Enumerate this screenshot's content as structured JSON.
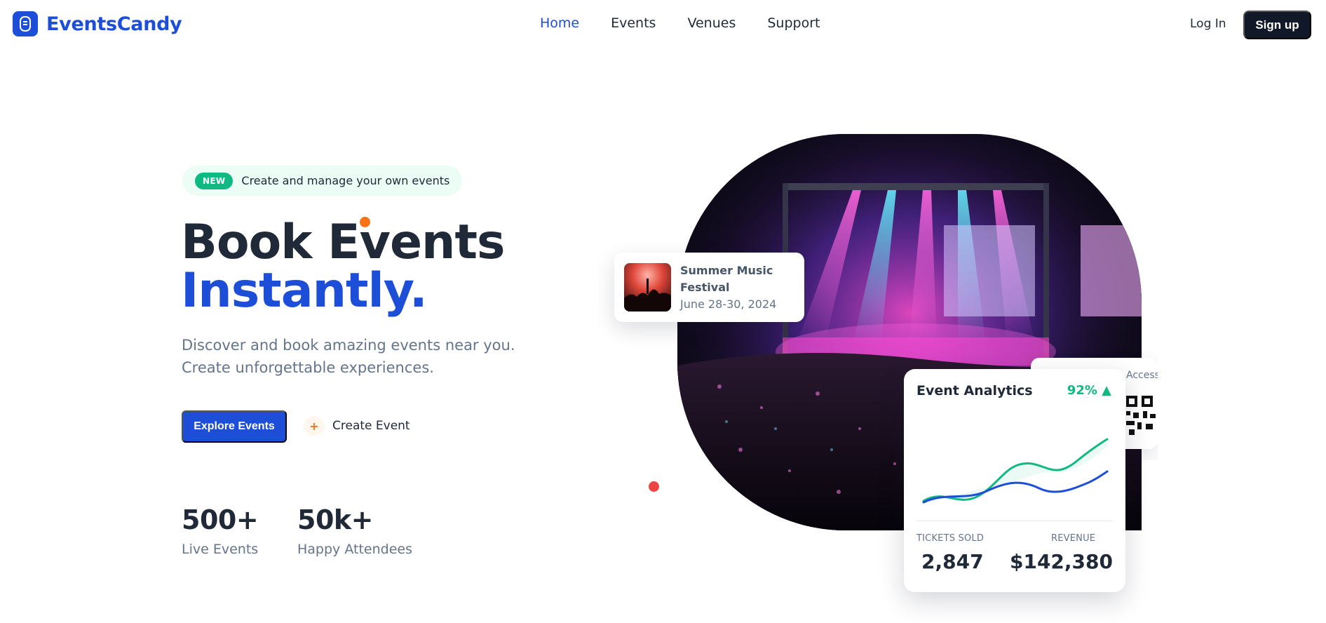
{
  "brand": {
    "name": "EventsCandy"
  },
  "nav": {
    "links": [
      {
        "label": "Home"
      },
      {
        "label": "Events"
      },
      {
        "label": "Venues"
      },
      {
        "label": "Support"
      }
    ],
    "login_label": "Log In",
    "signup_label": "Sign up"
  },
  "hero": {
    "badge": "NEW",
    "announcement": "Create and manage your own events",
    "title_line1": "Book Events",
    "title_line2": "Instantly.",
    "subtitle_line1": "Discover and book amazing events near you.",
    "subtitle_line2": "Create unforgettable experiences.",
    "primary_cta": "Explore Events",
    "secondary_cta": "Create Event",
    "stats": [
      {
        "value": "500+",
        "label": "Live Events"
      },
      {
        "value": "50k+",
        "label": "Happy Attendees"
      }
    ]
  },
  "event_card": {
    "name_line1": "Summer Music",
    "name_line2": "Festival",
    "date": "June 28-30, 2024"
  },
  "qr_card": {
    "label": "Access"
  },
  "analytics": {
    "title": "Event Analytics",
    "change": "92% ▲",
    "tickets_label": "TICKETS SOLD",
    "tickets_value": "2,847",
    "revenue_label": "REVENUE",
    "revenue_value": "$142,380"
  },
  "colors": {
    "brand_blue": "#1d4ed8",
    "dark": "#111827",
    "success": "#10b981",
    "accent_orange": "#f97316",
    "accent_red": "#ef4444"
  },
  "icons": {
    "logo": "ticket-icon",
    "create": "plus-icon"
  }
}
